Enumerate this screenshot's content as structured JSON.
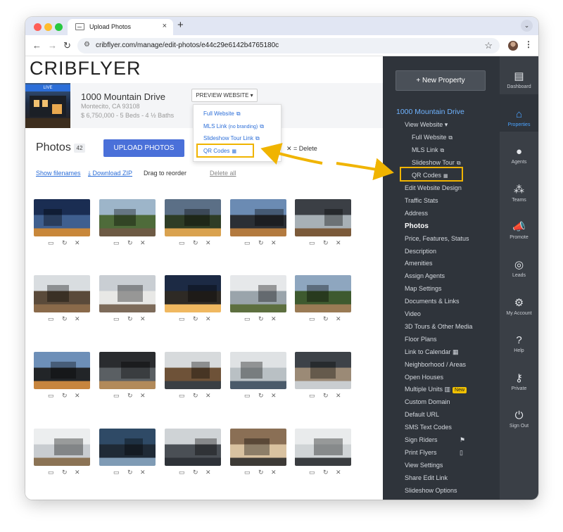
{
  "browser": {
    "tab_title": "Upload Photos",
    "tab_close": "×",
    "new_tab": "+",
    "tab_dropdown": "⌄",
    "url": "cribflyer.com/manage/edit-photos/e44c29e6142b4765180c",
    "back": "←",
    "forward": "→",
    "reload": "↻",
    "star": "☆",
    "menu": "⋮"
  },
  "logo": "CRIBFLYER",
  "property": {
    "live_badge": "LIVE",
    "name": "1000 Mountain Drive",
    "location": "Montecito, CA 93108",
    "meta": "$ 6,750,000 - 5 Beds - 4 ½ Baths"
  },
  "preview": {
    "button": "PREVIEW WEBSITE ▾",
    "items": {
      "full": "Full Website",
      "mls": "MLS Link",
      "mls_note": "(no branding)",
      "slideshow": "Slideshow Tour Link",
      "qr": "QR Codes"
    }
  },
  "photos": {
    "title": "Photos",
    "count": "42",
    "upload_button": "UPLOAD PHOTOS",
    "delete_legend": "✕ = Delete",
    "show_filenames": "Show filenames",
    "download_zip": "Download ZIP",
    "drag_reorder": "Drag to reorder",
    "delete_all": "Delete all"
  },
  "sidebar": {
    "new_property": "+ New Property",
    "heading": "1000 Mountain Drive",
    "view_website": "View Website ▾",
    "full_website": "Full Website",
    "mls_link": "MLS Link",
    "slideshow_tour": "Slideshow Tour",
    "qr_codes": "QR Codes",
    "items": [
      "Edit Website Design",
      "Traffic Stats",
      "Address",
      "Photos",
      "Price, Features, Status",
      "Description",
      "Amenities",
      "Assign Agents",
      "Map Settings",
      "Documents & Links",
      "Video",
      "3D Tours & Other Media",
      "Floor Plans",
      "Link to Calendar",
      "Neighborhood / Areas",
      "Open Houses",
      "Multiple Units",
      "Custom Domain",
      "Default URL",
      "SMS Text Codes",
      "Sign Riders",
      "Print Flyers",
      "View Settings",
      "Share Edit Link",
      "Slideshow Options"
    ],
    "new_badge": "New"
  },
  "rail": [
    {
      "label": "Dashboard",
      "icon": "dashboard-icon",
      "glyph": "▤"
    },
    {
      "label": "Properties",
      "icon": "properties-icon",
      "glyph": "⌂"
    },
    {
      "label": "Agents",
      "icon": "agent-icon",
      "glyph": "●"
    },
    {
      "label": "Teams",
      "icon": "teams-icon",
      "glyph": "⁂"
    },
    {
      "label": "Promote",
      "icon": "megaphone-icon",
      "glyph": "📣"
    },
    {
      "label": "Leads",
      "icon": "target-icon",
      "glyph": "◎"
    },
    {
      "label": "My Account",
      "icon": "gear-icon",
      "glyph": "⚙"
    },
    {
      "label": "Help",
      "icon": "help-icon",
      "glyph": "?"
    },
    {
      "label": "Private",
      "icon": "key-icon",
      "glyph": "⚷"
    },
    {
      "label": "Sign Out",
      "icon": "power-icon",
      "glyph": "⏻"
    }
  ],
  "colors": {
    "accent_blue": "#2c6ed8",
    "upload_blue": "#4a70d9",
    "sidebar_bg": "#2f343b",
    "highlight": "#f0b400"
  }
}
